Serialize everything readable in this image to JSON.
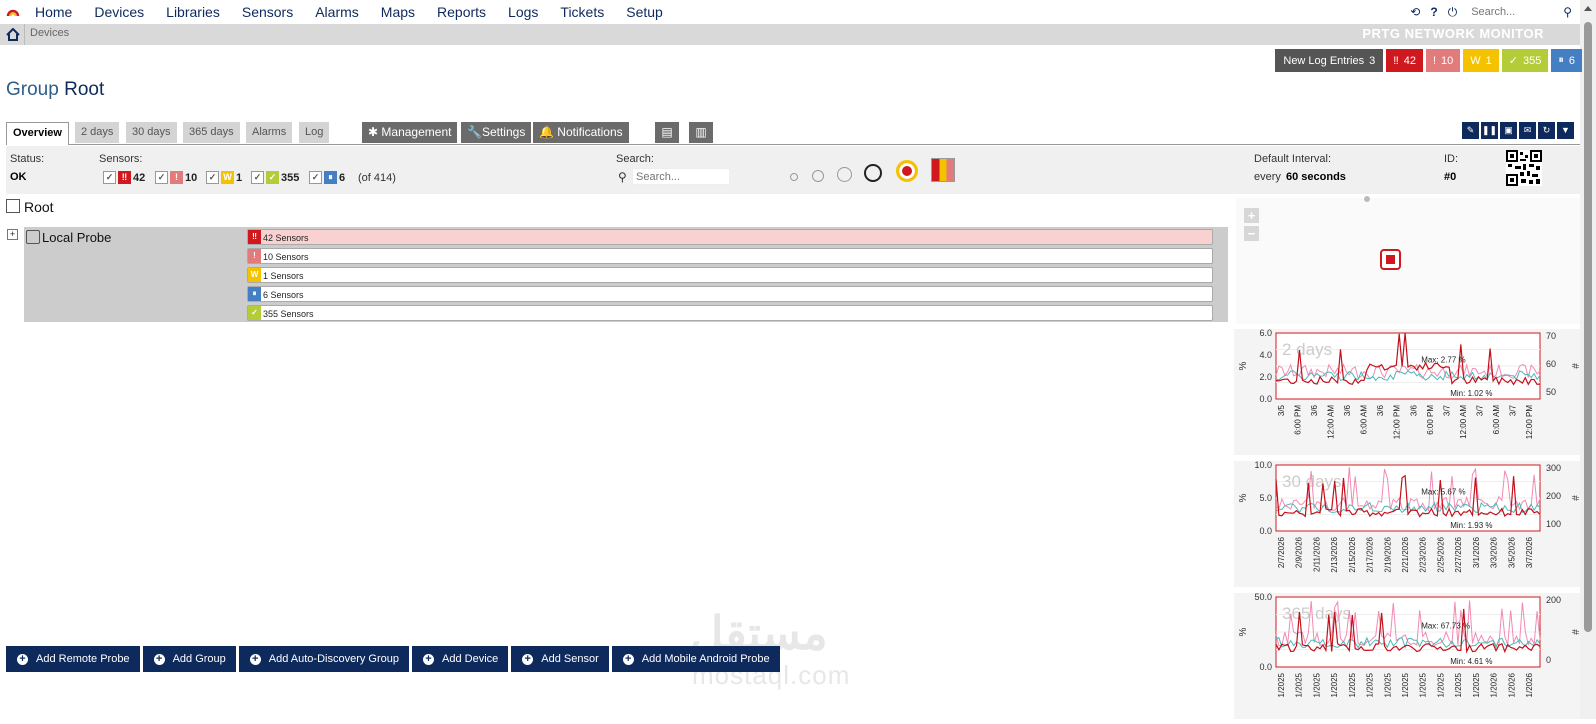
{
  "nav": {
    "items": [
      "Home",
      "Devices",
      "Libraries",
      "Sensors",
      "Alarms",
      "Maps",
      "Reports",
      "Logs",
      "Tickets",
      "Setup"
    ],
    "search_placeholder": "Search..."
  },
  "breadcrumb": {
    "current": "Devices",
    "brand": "PRTG NETWORK MONITOR"
  },
  "counters": {
    "log_label": "New Log Entries",
    "log_count": "3",
    "down": "42",
    "partial": "10",
    "warning": "1",
    "up": "355",
    "paused": "6"
  },
  "page": {
    "group_word": "Group",
    "name": "Root"
  },
  "tabs": [
    "Overview",
    "2 days",
    "30 days",
    "365 days",
    "Alarms",
    "Log"
  ],
  "actions": [
    "Management",
    "Settings",
    "Notifications"
  ],
  "info": {
    "status_label": "Status:",
    "status_value": "OK",
    "sensors_label": "Sensors:",
    "filter_counts": [
      "42",
      "10",
      "1",
      "355",
      "6"
    ],
    "total": "(of 414)",
    "search_label": "Search:",
    "search_placeholder": "Search...",
    "interval_label": "Default Interval:",
    "interval_prefix": "every",
    "interval_value": "60 seconds",
    "id_label": "ID:",
    "id_value": "#0"
  },
  "tree": {
    "root": "Root",
    "probe": "Local Probe",
    "bars": [
      "42 Sensors",
      "10 Sensors",
      "1 Sensors",
      "6 Sensors",
      "355 Sensors"
    ]
  },
  "graphs": [
    {
      "period": "2 days",
      "max": "Max: 2.77 %",
      "min": "Min: 1.02 %",
      "yleft": [
        "6.0",
        "4.0",
        "2.0",
        "0.0"
      ],
      "yright": [
        "70",
        "60",
        "50"
      ],
      "xticks": [
        "3/5",
        "6:00 PM",
        "3/6",
        "12:00 AM",
        "3/6",
        "6:00 AM",
        "3/6",
        "12:00 PM",
        "3/6",
        "6:00 PM",
        "3/7",
        "12:00 AM",
        "3/7",
        "6:00 AM",
        "3/7",
        "12:00 PM"
      ]
    },
    {
      "period": "30 days",
      "max": "Max: 5.67 %",
      "min": "Min: 1.93 %",
      "yleft": [
        "10.0",
        "5.0",
        "0.0"
      ],
      "yright": [
        "300",
        "200",
        "100"
      ],
      "xticks": [
        "2/7/2026",
        "2/9/2026",
        "2/11/2026",
        "2/13/2026",
        "2/15/2026",
        "2/17/2026",
        "2/19/2026",
        "2/21/2026",
        "2/23/2026",
        "2/25/2026",
        "2/27/2026",
        "3/1/2026",
        "3/3/2026",
        "3/5/2026",
        "3/7/2026"
      ]
    },
    {
      "period": "365 days",
      "max": "Max: 67.73 %",
      "min": "Min: 4.61 %",
      "yleft": [
        "50.0",
        "0.0"
      ],
      "yright": [
        "200",
        "0"
      ],
      "xticks": [
        "1/2025",
        "1/2025",
        "1/2025",
        "1/2025",
        "1/2025",
        "1/2025",
        "1/2025",
        "1/2025",
        "1/2025",
        "1/2025",
        "1/2025",
        "1/2025",
        "1/2026",
        "1/2026",
        "1/2026"
      ]
    }
  ],
  "graph_axis": {
    "left_unit": "%",
    "right_unit": "#"
  },
  "buttons": [
    "Add Remote Probe",
    "Add Group",
    "Add Auto-Discovery Group",
    "Add Device",
    "Add Sensor",
    "Add Mobile Android Probe"
  ],
  "watermark": {
    "arabic": "مستقل",
    "latin": "mostaql.com"
  },
  "colors": {
    "navy": "#0e2a5c",
    "down": "#d0181f",
    "partial": "#e27b7b",
    "warning": "#f5c200",
    "up": "#b4cc38",
    "paused": "#447fc4"
  }
}
